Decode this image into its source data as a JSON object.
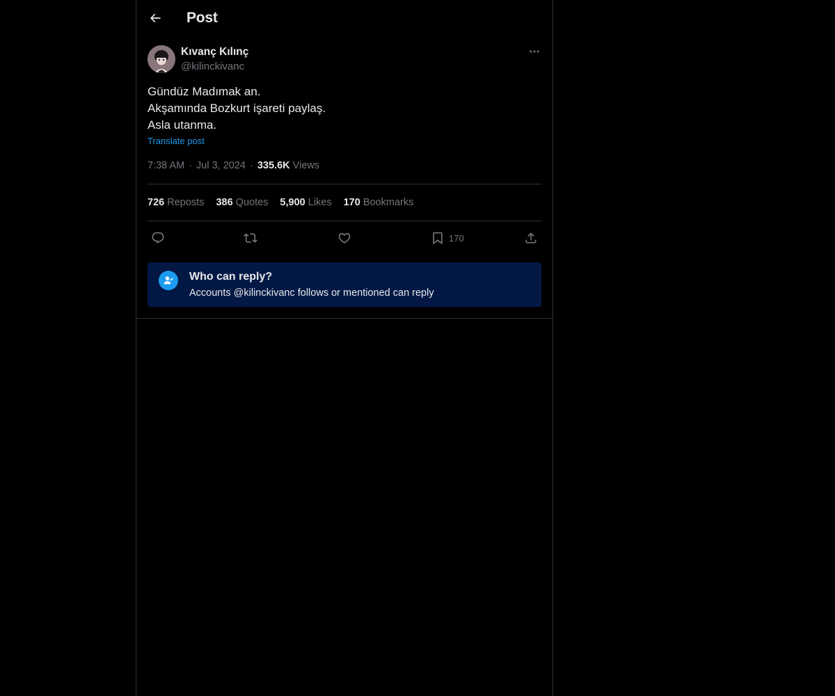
{
  "header": {
    "title": "Post",
    "back_icon": "arrow-left-icon"
  },
  "post": {
    "author": {
      "name": "Kıvanç Kılınç",
      "handle": "@kilinckivanc"
    },
    "text_lines": [
      "Gündüz Madımak an.",
      "Akşamında Bozkurt işareti paylaş.",
      "Asla utanma."
    ],
    "translate_label": "Translate post",
    "time": "7:38 AM",
    "date": "Jul 3, 2024",
    "views_count": "335.6K",
    "views_label": "Views",
    "separator": "·",
    "stats": {
      "reposts": {
        "count": "726",
        "label": "Reposts"
      },
      "quotes": {
        "count": "386",
        "label": "Quotes"
      },
      "likes": {
        "count": "5,900",
        "label": "Likes"
      },
      "bookmarks": {
        "count": "170",
        "label": "Bookmarks"
      }
    },
    "actions": {
      "bookmark_count": "170"
    }
  },
  "reply_settings": {
    "title": "Who can reply?",
    "subtitle": "Accounts @kilinckivanc follows or mentioned can reply"
  },
  "colors": {
    "background": "#000000",
    "text": "#e7e9ea",
    "muted": "#71767b",
    "accent": "#1d9bf0",
    "divider": "#2f3336",
    "reply_box": "#031845"
  }
}
